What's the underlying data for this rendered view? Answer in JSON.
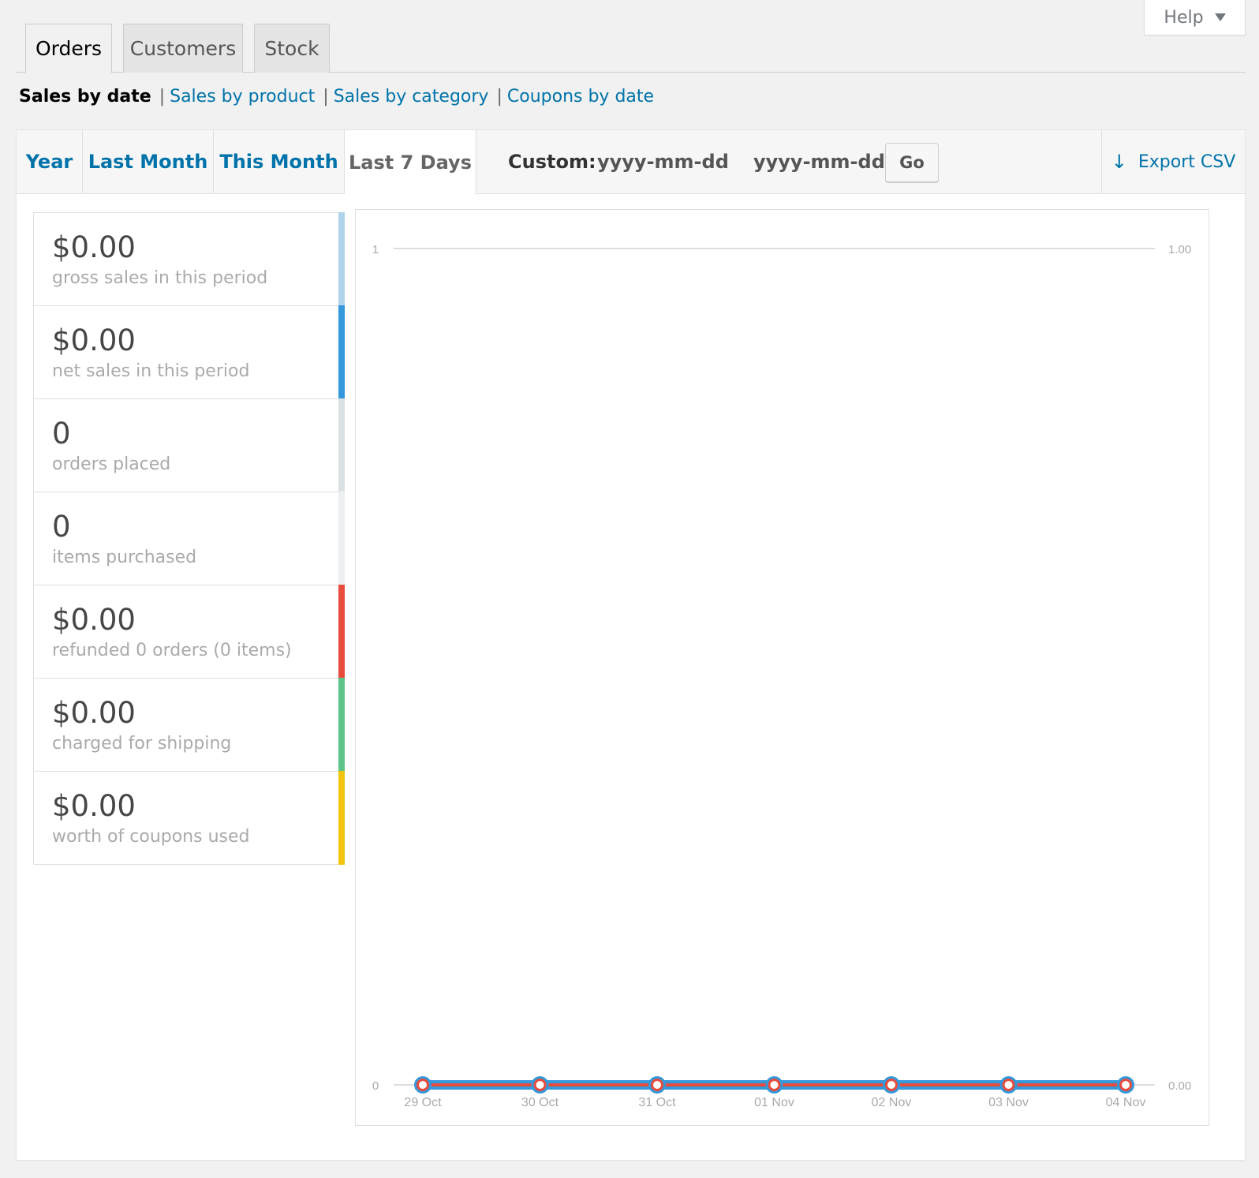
{
  "help": {
    "label": "Help"
  },
  "nav_tabs": [
    {
      "label": "Orders",
      "active": true
    },
    {
      "label": "Customers",
      "active": false
    },
    {
      "label": "Stock",
      "active": false
    }
  ],
  "report_links": {
    "current": "Sales by date",
    "links": [
      "Sales by product",
      "Sales by category",
      "Coupons by date"
    ]
  },
  "range_tabs": [
    {
      "label": "Year",
      "active": false
    },
    {
      "label": "Last Month",
      "active": false
    },
    {
      "label": "This Month",
      "active": false
    },
    {
      "label": "Last 7 Days",
      "active": true
    }
  ],
  "custom": {
    "label": "Custom:",
    "start_placeholder": "yyyy-mm-dd",
    "end_placeholder": "yyyy-mm-dd",
    "go_label": "Go"
  },
  "export": {
    "label": "Export CSV",
    "icon": "download-arrow-icon"
  },
  "legend": [
    {
      "amount": "$0.00",
      "desc": "gross sales in this period",
      "color": "#b1d4ea"
    },
    {
      "amount": "$0.00",
      "desc": "net sales in this period",
      "color": "#3498db"
    },
    {
      "amount": "0",
      "desc": "orders placed",
      "color": "#dbe1e3"
    },
    {
      "amount": "0",
      "desc": "items purchased",
      "color": "#ecf0f1"
    },
    {
      "amount": "$0.00",
      "desc": "refunded 0 orders (0 items)",
      "color": "#e74c3c"
    },
    {
      "amount": "$0.00",
      "desc": "charged for shipping",
      "color": "#5cc488"
    },
    {
      "amount": "$0.00",
      "desc": "worth of coupons used",
      "color": "#f1c40f"
    }
  ],
  "chart_data": {
    "type": "line",
    "categories": [
      "29 Oct",
      "30 Oct",
      "31 Oct",
      "01 Nov",
      "02 Nov",
      "03 Nov",
      "04 Nov"
    ],
    "series": [
      {
        "values": [
          0,
          0,
          0,
          0,
          0,
          0,
          0
        ],
        "color": "#3498db"
      },
      {
        "values": [
          0,
          0,
          0,
          0,
          0,
          0,
          0
        ],
        "color": "#e74c3c"
      }
    ],
    "left_axis": {
      "ticks": [
        "0",
        "1"
      ],
      "ylim": [
        0,
        1
      ]
    },
    "right_axis": {
      "ticks": [
        "0.00",
        "1.00"
      ],
      "ylim": [
        0,
        1
      ]
    },
    "grid": true
  }
}
